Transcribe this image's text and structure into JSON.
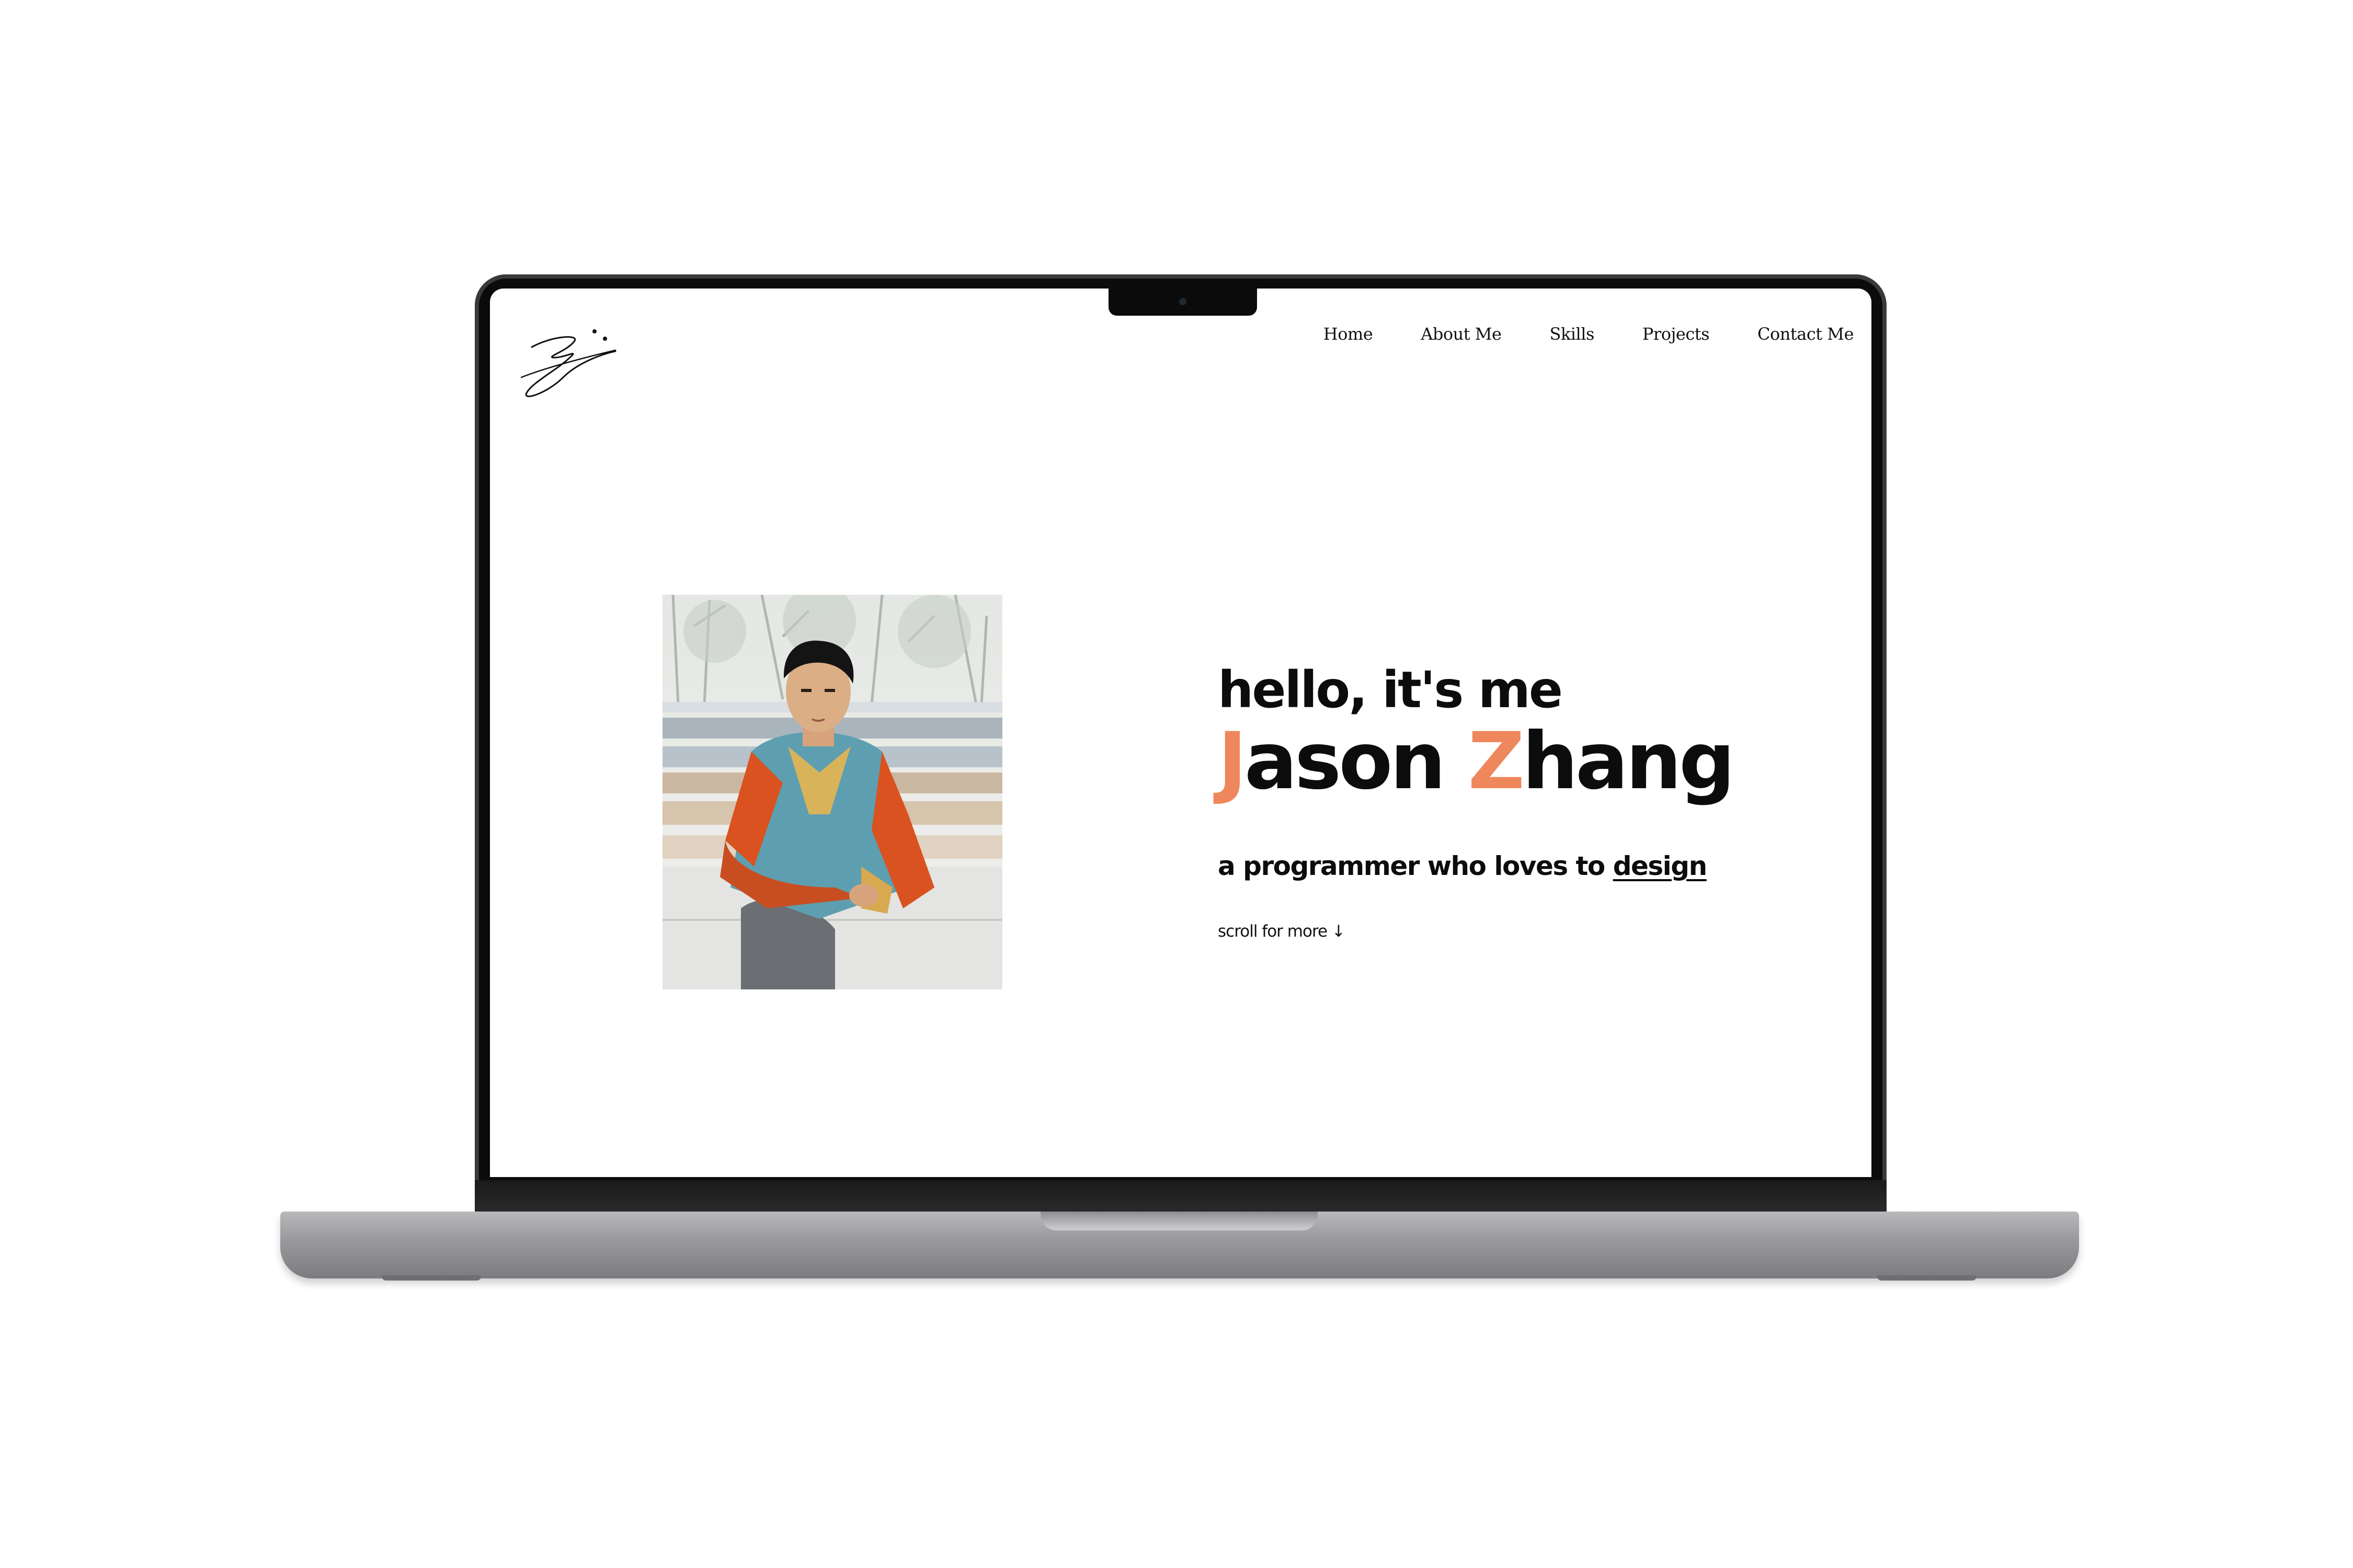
{
  "colors": {
    "accent": "#ee875c",
    "text": "#0c0c0c"
  },
  "site": {
    "logo": {
      "icon": "signature-logo-icon"
    },
    "nav": [
      "Home",
      "About Me",
      "Skills",
      "Projects",
      "Contact Me"
    ]
  },
  "hero": {
    "portrait_icon": "portrait-photo",
    "greeting": "hello, it's me",
    "name": {
      "first_initial": "J",
      "first_rest": "ason",
      "space": " ",
      "last_initial": "Z",
      "last_rest": "hang"
    },
    "tagline": {
      "prefix": "a programmer who loves to ",
      "link": "design"
    },
    "scroll": "scroll for more",
    "scroll_arrow": "↓"
  }
}
